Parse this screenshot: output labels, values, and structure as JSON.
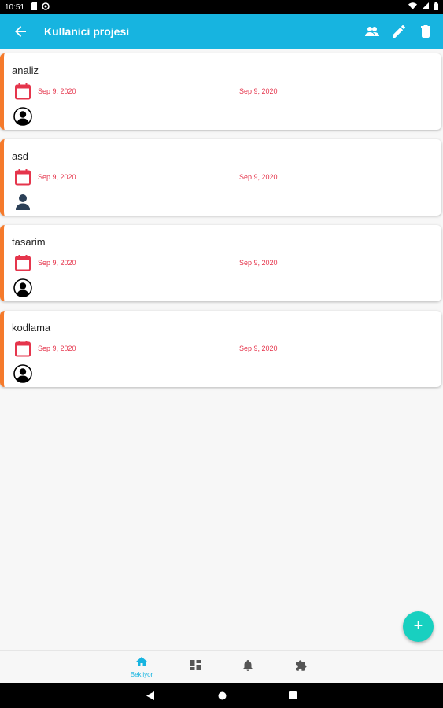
{
  "status_bar": {
    "time": "10:51",
    "icons": [
      "sd-card-icon",
      "sync-icon",
      "wifi-icon",
      "signal-icon",
      "battery-icon"
    ]
  },
  "app_bar": {
    "title": "Kullanici projesi",
    "background": "#17b4e0",
    "icons": [
      "back-arrow-icon",
      "people-icon",
      "edit-icon",
      "delete-icon"
    ]
  },
  "tasks": [
    {
      "name": "analiz",
      "start_date": "Sep 9, 2020",
      "end_date": "Sep 9, 2020",
      "avatar": "user-outline-icon"
    },
    {
      "name": "asd",
      "start_date": "Sep 9, 2020",
      "end_date": "Sep 9, 2020",
      "avatar": "user-filled-icon"
    },
    {
      "name": "tasarim",
      "start_date": "Sep 9, 2020",
      "end_date": "Sep 9, 2020",
      "avatar": "user-outline-icon"
    },
    {
      "name": "kodlama",
      "start_date": "Sep 9, 2020",
      "end_date": "Sep 9, 2020",
      "avatar": "user-outline-icon"
    }
  ],
  "colors": {
    "accent_bar": "#f57a2b",
    "date_text": "#e5354c",
    "fab": "#18d0c0"
  },
  "fab": {
    "label": "+"
  },
  "bottom_nav": {
    "items": [
      {
        "icon": "home-icon",
        "label": "Bekliyor",
        "active": true
      },
      {
        "icon": "dashboard-icon",
        "label": "",
        "active": false
      },
      {
        "icon": "bell-icon",
        "label": "",
        "active": false
      },
      {
        "icon": "puzzle-icon",
        "label": "",
        "active": false
      }
    ]
  }
}
